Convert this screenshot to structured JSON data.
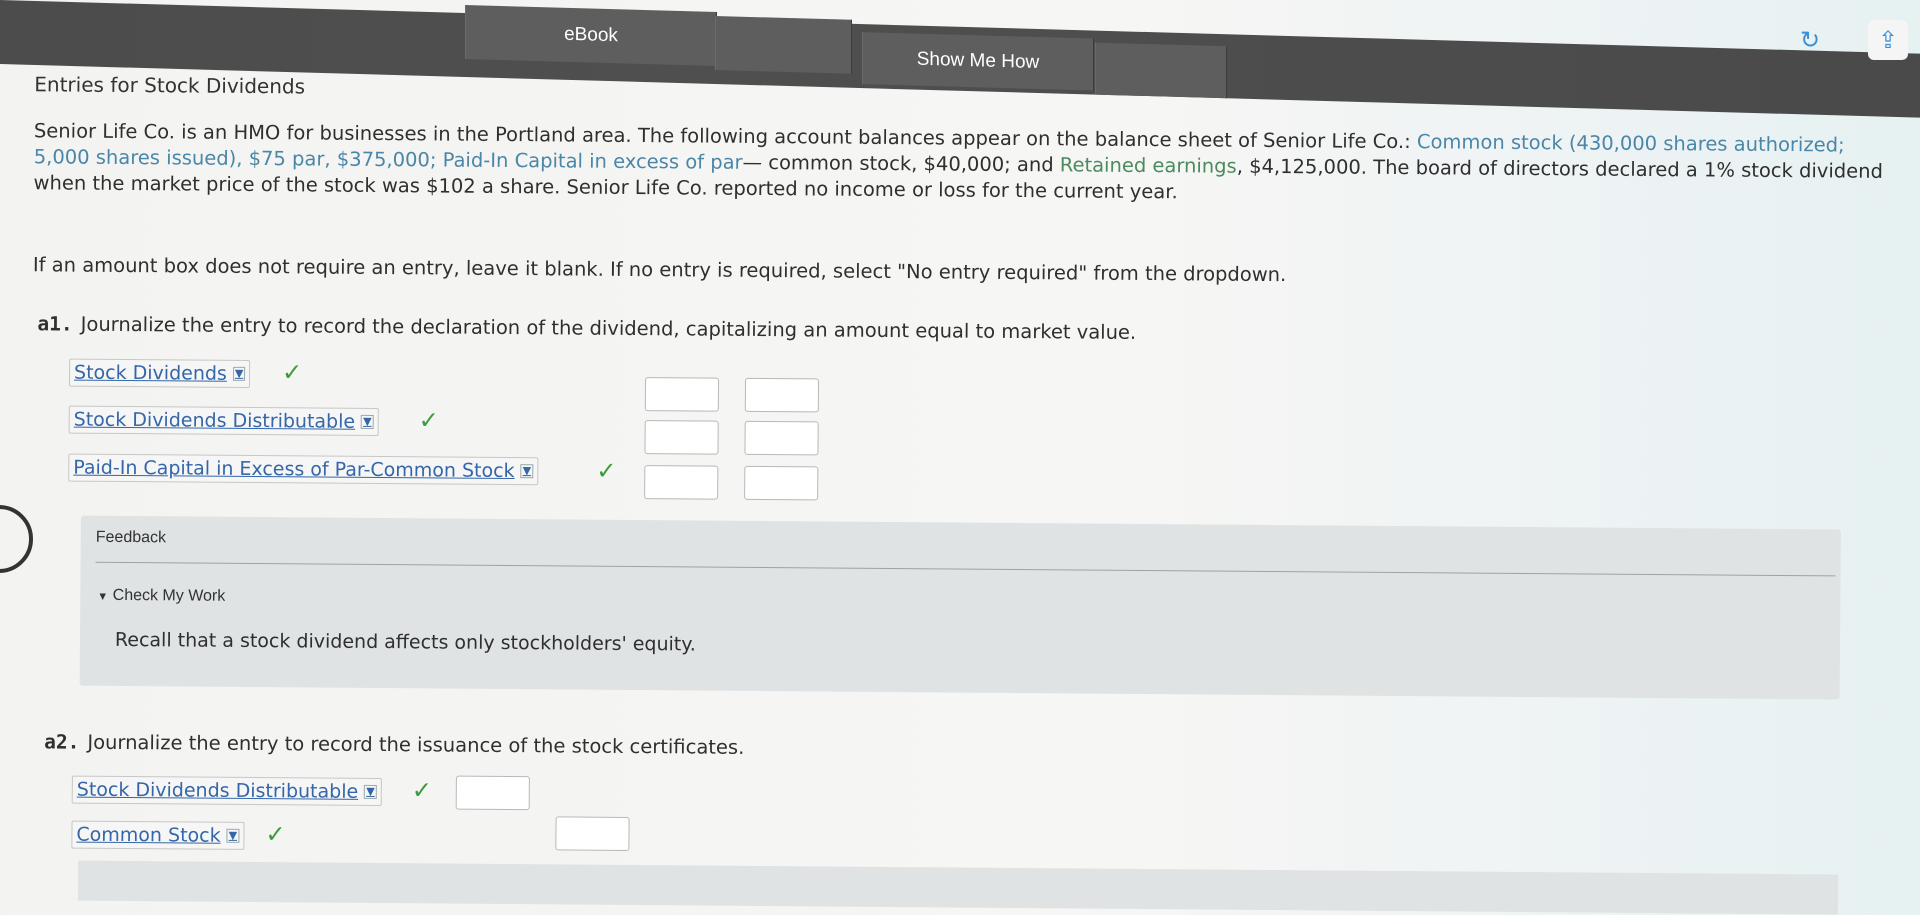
{
  "toolbar": {
    "tabs": [
      {
        "label": "eBook"
      },
      {
        "label": ""
      },
      {
        "label": "Show Me How"
      },
      {
        "label": ""
      }
    ],
    "icons": {
      "refresh": "refresh-icon",
      "share": "share-icon"
    },
    "accent": "#3b8fd6"
  },
  "problem": {
    "title": "Entries for Stock Dividends",
    "para1_a": "Senior Life Co. is an HMO for businesses in the Portland area. The following account balances appear on the balance sheet of Senior Life Co.: ",
    "para1_common": "Common stock (430,000 shares authorized; 5,000 shares issued), $75 par, $375,000;",
    "para1_paid": "Paid-In Capital in excess of par",
    "para1_b": "— common stock, $40,000; and ",
    "para1_retained": "Retained earnings",
    "para1_c": ", $4,125,000. The board of directors declared a 1% stock dividend when the market price of the stock was $102 a share. Senior Life Co. reported no income or loss for the current year.",
    "instructions": "If an amount box does not require an entry, leave it blank. If no entry is required, select \"No entry required\" from the dropdown."
  },
  "a1": {
    "number": "a1.",
    "prompt": "Journalize the entry to record the declaration of the dividend, capitalizing an amount equal to market value.",
    "rows": [
      {
        "account": "Stock Dividends",
        "debit": "",
        "credit": ""
      },
      {
        "account": "Stock Dividends Distributable",
        "debit": "",
        "credit": ""
      },
      {
        "account": "Paid-In Capital in Excess of Par-Common Stock",
        "debit": "",
        "credit": ""
      }
    ]
  },
  "feedback": {
    "label": "Feedback",
    "check_label": "Check My Work",
    "text": "Recall that a stock dividend affects only stockholders' equity."
  },
  "a2": {
    "number": "a2.",
    "prompt": "Journalize the entry to record the issuance of the stock certificates.",
    "rows": [
      {
        "account": "Stock Dividends Distributable",
        "debit": ""
      },
      {
        "account": "Common Stock",
        "credit": ""
      }
    ]
  },
  "colors": {
    "check": "#3a9c3a",
    "link": "#3466a8"
  }
}
